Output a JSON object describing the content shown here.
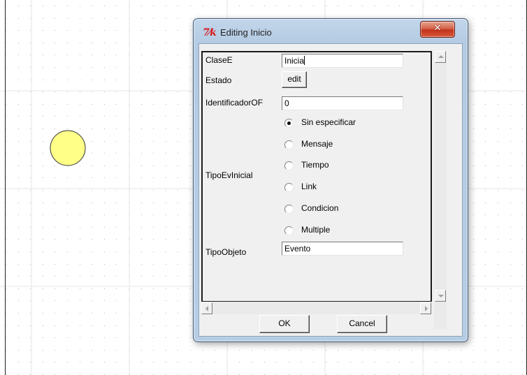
{
  "dialog": {
    "title": "Editing Inicio",
    "icon_glyph": "7⁄k",
    "close_glyph": "✕"
  },
  "properties": {
    "clase_label": "ClaseE",
    "clase_value": "Inicia",
    "estado_label": "Estado",
    "estado_button": "edit",
    "identificador_label": "IdentificadorOF",
    "identificador_value": "0",
    "tipo_ev_label": "TipoEvInicial",
    "tipo_ev_options": [
      "Sin especificar",
      "Mensaje",
      "Tiempo",
      "Link",
      "Condicion",
      "Multiple"
    ],
    "tipo_ev_selected": "Sin especificar",
    "tipo_objeto_label": "TipoObjeto",
    "tipo_objeto_value": "Evento"
  },
  "buttons": {
    "ok": "OK",
    "cancel": "Cancel"
  },
  "colors": {
    "canvas_grid": "#b5b5b5",
    "circle_fill": "#ffff88",
    "circle_stroke": "#333333"
  },
  "icons": {
    "close": "close-icon",
    "tk": "tk-app-icon",
    "scroll_up": "arrow-up-icon",
    "scroll_down": "arrow-down-icon",
    "scroll_left": "arrow-left-icon",
    "scroll_right": "arrow-right-icon"
  }
}
